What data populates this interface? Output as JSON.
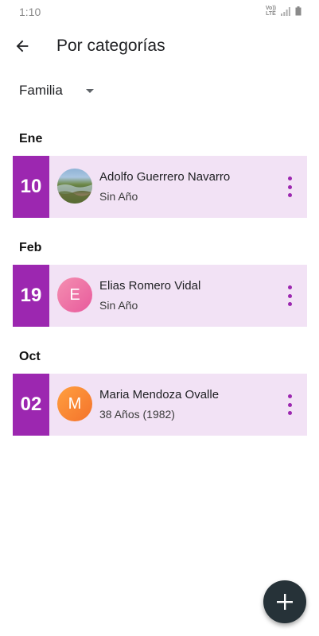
{
  "status": {
    "time": "1:10",
    "volte_line1": "Vo))",
    "volte_line2": "LTE"
  },
  "header": {
    "title": "Por categorías",
    "back_icon": "arrow-back-icon"
  },
  "filter": {
    "category": "Familia"
  },
  "colors": {
    "accent": "#9c27b0",
    "card_bg": "#f2e2f5",
    "fab_bg": "#263238"
  },
  "groups": [
    {
      "month": "Ene",
      "entries": [
        {
          "day": "10",
          "name": "Adolfo Guerrero Navarro",
          "age": "Sin Año",
          "avatar_letter": ""
        }
      ]
    },
    {
      "month": "Feb",
      "entries": [
        {
          "day": "19",
          "name": "Elias Romero Vidal",
          "age": "Sin Año",
          "avatar_letter": "E"
        }
      ]
    },
    {
      "month": "Oct",
      "entries": [
        {
          "day": "02",
          "name": "Maria Mendoza Ovalle",
          "age": "38 Años (1982)",
          "avatar_letter": "M"
        }
      ]
    }
  ],
  "fab": {
    "icon": "add-icon"
  }
}
